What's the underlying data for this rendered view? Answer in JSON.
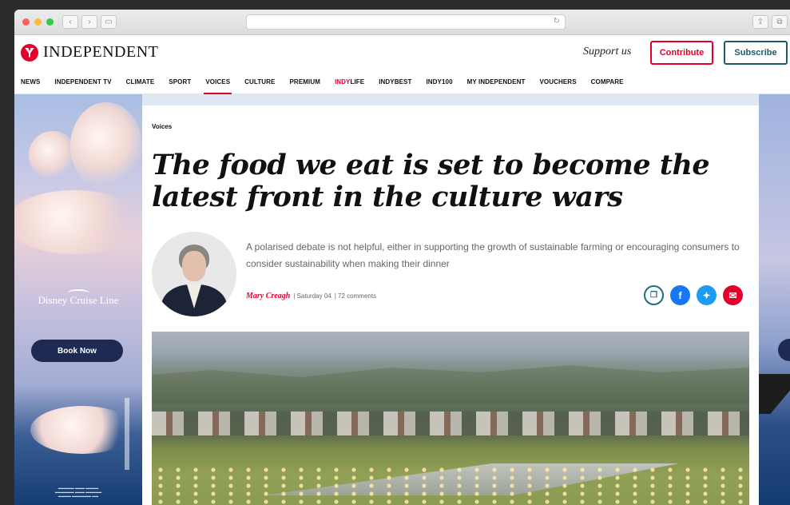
{
  "site": {
    "logo_text": "INDEPENDENT",
    "support_text": "Support us",
    "contribute_label": "Contribute",
    "subscribe_label": "Subscribe",
    "brand_color": "#e4002b",
    "subscribe_color": "#1e5a6e"
  },
  "nav": {
    "items": [
      "NEWS",
      "INDEPENDENT TV",
      "CLIMATE",
      "SPORT",
      "VOICES",
      "CULTURE",
      "PREMIUM",
      "INDY",
      "LIFE",
      "INDYBEST",
      "INDY100",
      "MY INDEPENDENT",
      "VOUCHERS",
      "COMPARE"
    ],
    "active": "VOICES"
  },
  "article": {
    "section": "Voices",
    "headline": "The food we eat is set to become the latest front in the culture wars",
    "standfirst": "A polarised debate is not helpful, either in supporting the growth of sustainable farming or encouraging consumers to consider sustainability when making their dinner",
    "author": "Mary Creagh",
    "date": "| Saturday 04",
    "comments": "| 72 comments"
  },
  "ad": {
    "brand": "Disney Cruise Line",
    "cta": "Book Now"
  }
}
